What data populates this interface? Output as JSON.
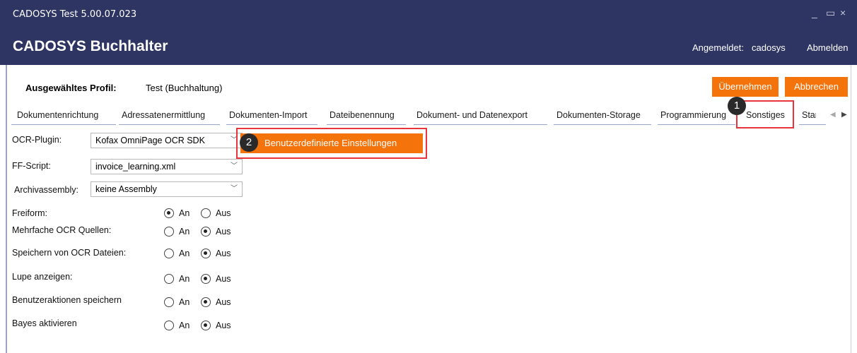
{
  "window": {
    "title": "CADOSYS Test 5.00.07.023",
    "minimize_glyph": "_",
    "maximize_glyph": "▭",
    "close_glyph": "×"
  },
  "header": {
    "title": "CADOSYS  Buchhalter",
    "logged_in_label": "Angemeldet:",
    "user": "cadosys",
    "logout": "Abmelden"
  },
  "profile": {
    "label": "Ausgewähltes Profil:",
    "value": "Test (Buchhaltung)"
  },
  "actions": {
    "apply": "Übernehmen",
    "cancel": "Abbrechen"
  },
  "tabs": [
    "Dokumentenrichtung",
    "Adressatenermittlung",
    "Dokumenten-Import",
    "Dateibenennung",
    "Dokument- und Datenexport",
    "Dokumenten-Storage",
    "Programmierung",
    "Sonstiges",
    "Star"
  ],
  "tab_selected": "Sonstiges",
  "badges": {
    "one": "1",
    "two": "2"
  },
  "fields": {
    "ocr_plugin": {
      "label": "OCR-Plugin:",
      "value": "Kofax OmniPage OCR SDK"
    },
    "ff_script": {
      "label": "FF-Script:",
      "value": "invoice_learning.xml"
    },
    "archive": {
      "label": "Archivassembly:",
      "value": "keine Assembly"
    }
  },
  "custom_button": "Benutzerdefinierte Einstellungen",
  "options": [
    {
      "label": "Freiform:",
      "on_label": "An",
      "off_label": "Aus",
      "value": "An"
    },
    {
      "label": "Mehrfache OCR Quellen:",
      "on_label": "An",
      "off_label": "Aus",
      "value": "Aus"
    },
    {
      "label": "Speichern von OCR Dateien:",
      "on_label": "An",
      "off_label": "Aus",
      "value": "Aus"
    },
    {
      "label": "Lupe anzeigen:",
      "on_label": "An",
      "off_label": "Aus",
      "value": "Aus"
    },
    {
      "label": "Benutzeraktionen speichern",
      "on_label": "An",
      "off_label": "Aus",
      "value": "Aus"
    },
    {
      "label": "Bayes aktivieren",
      "on_label": "An",
      "off_label": "Aus",
      "value": "Aus"
    }
  ],
  "colors": {
    "header": "#2e3563",
    "accent": "#f5730b",
    "highlight": "#e8343c"
  }
}
